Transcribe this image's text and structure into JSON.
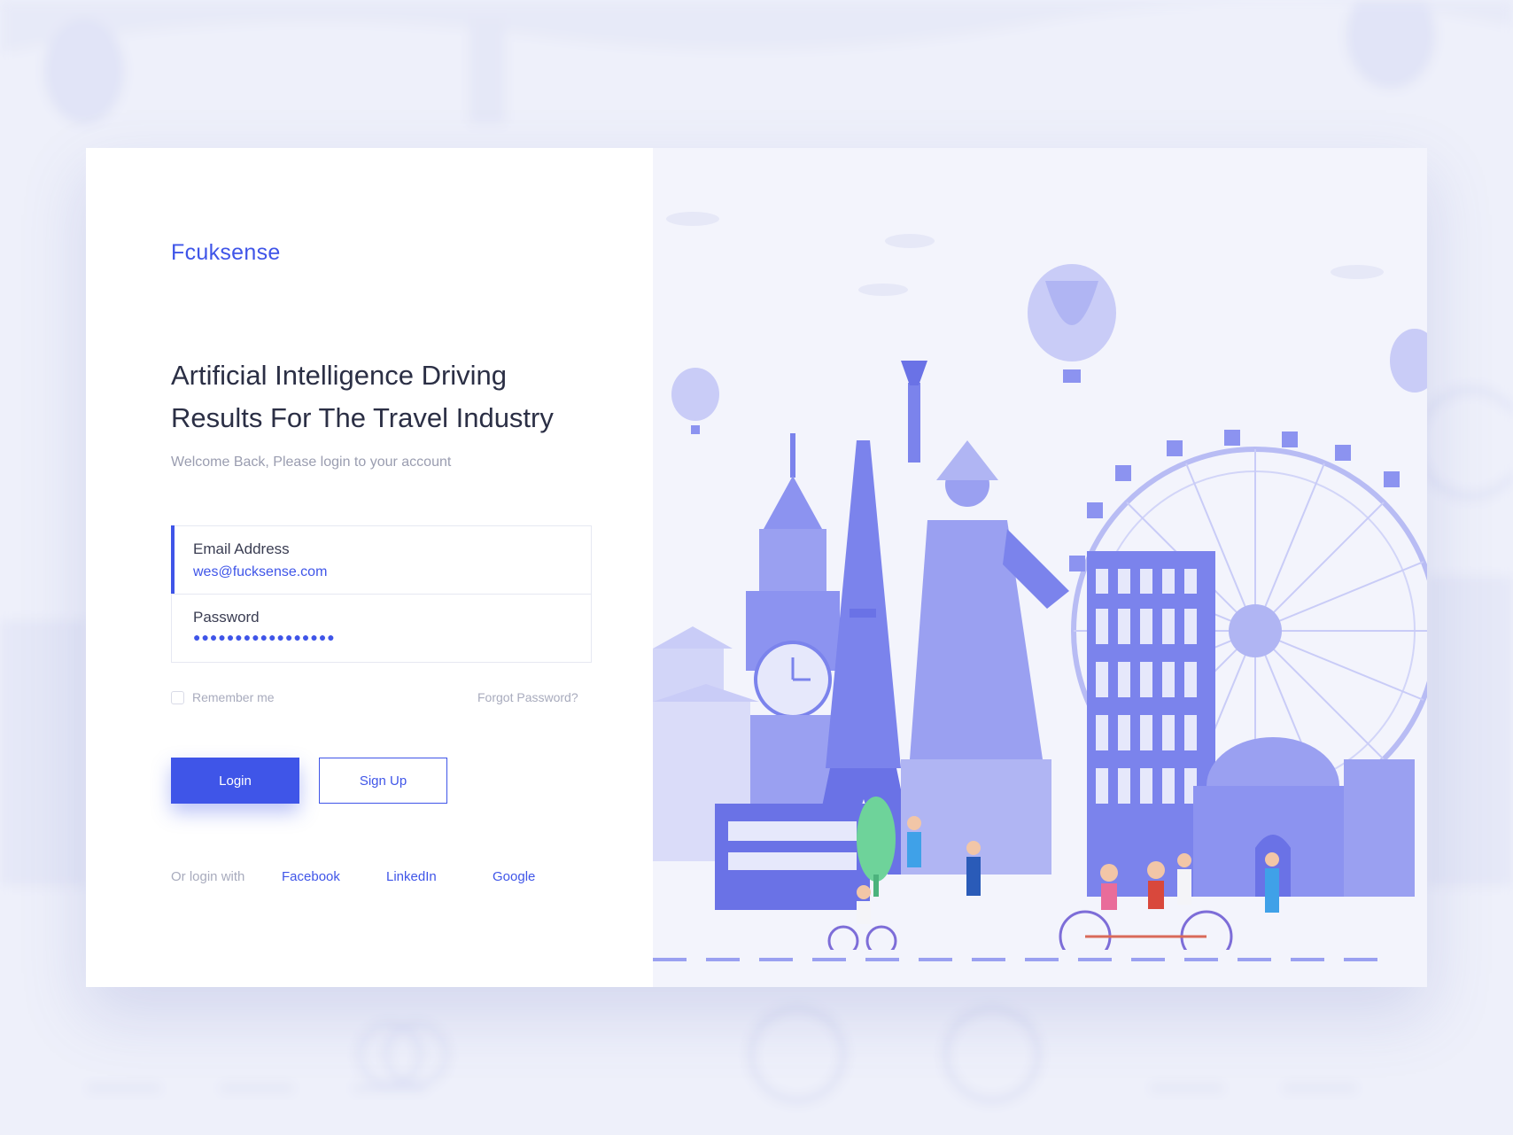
{
  "brand": {
    "name": "Fcuksense"
  },
  "headline": {
    "line1": "Artificial Intelligence Driving",
    "line2": "Results For The Travel Industry"
  },
  "subtitle": "Welcome Back, Please login to your account",
  "form": {
    "email_label": "Email Address",
    "email_value": "wes@fucksense.com",
    "password_label": "Password",
    "password_value": "●●●●●●●●●●●●●●●●●"
  },
  "options": {
    "remember_label": "Remember me",
    "forgot_label": "Forgot Password?"
  },
  "buttons": {
    "login_label": "Login",
    "signup_label": "Sign Up"
  },
  "social": {
    "prompt": "Or login with",
    "facebook": "Facebook",
    "linkedin": "LinkedIn",
    "google": "Google"
  },
  "colors": {
    "accent": "#3f55e8",
    "illustration": "#8c93f0",
    "illustration_light": "#c9ccf7",
    "background": "#eef0fa"
  }
}
